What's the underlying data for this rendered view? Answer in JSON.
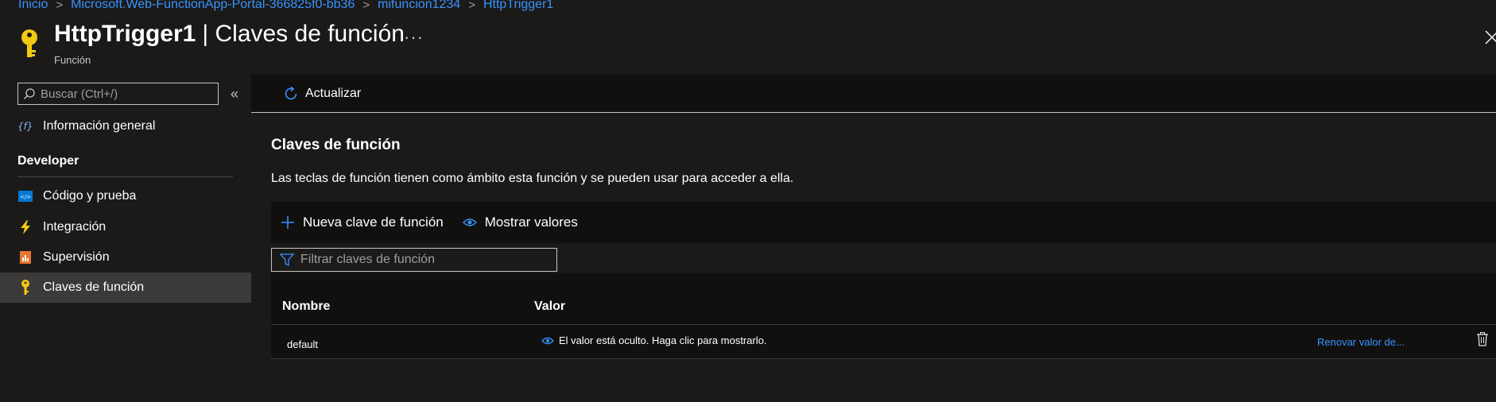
{
  "breadcrumb": {
    "items": [
      "Inicio",
      "Microsoft.Web-FunctionApp-Portal-366825f0-bb36",
      "mifuncion1234",
      "HttpTrigger1"
    ],
    "separator": ">"
  },
  "header": {
    "title_bold": "HttpTrigger1",
    "title_rest": "| Claves de función",
    "subtitle": "Función",
    "more_label": "···",
    "icon": "key-icon"
  },
  "sidebar": {
    "search_placeholder": "Buscar (Ctrl+/)",
    "collapse_label": "«",
    "overview_label": "Información general",
    "section_developer": "Developer",
    "items": [
      {
        "label": "Código y prueba",
        "icon": "code-icon"
      },
      {
        "label": "Integración",
        "icon": "lightning-icon"
      },
      {
        "label": "Supervisión",
        "icon": "monitor-icon"
      },
      {
        "label": "Claves de función",
        "icon": "key-icon",
        "selected": true
      }
    ]
  },
  "toolbar": {
    "refresh_label": "Actualizar"
  },
  "main": {
    "section_title": "Claves de función",
    "description": "Las teclas de función tienen como ámbito esta función y se pueden usar para acceder a ella.",
    "new_key_label": "Nueva clave de función",
    "show_values_label": "Mostrar valores",
    "filter_placeholder": "Filtrar claves de función",
    "table": {
      "headers": [
        "Nombre",
        "Valor"
      ],
      "rows": [
        {
          "name": "default",
          "value": "El valor está oculto. Haga clic para mostrarlo.",
          "action": "Renovar valor de..."
        }
      ]
    }
  },
  "colors": {
    "accent": "#3794ff",
    "background": "#1b1a19",
    "key_yellow": "#f2c811",
    "selected_bg": "#3b3a39"
  }
}
